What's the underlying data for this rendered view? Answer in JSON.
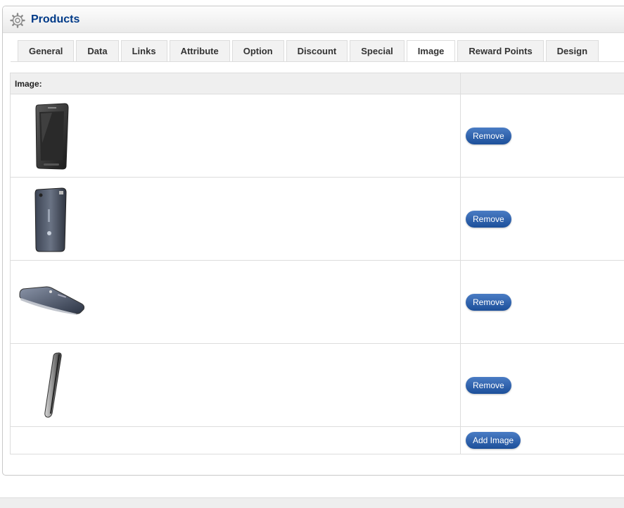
{
  "header": {
    "title": "Products",
    "icon": "gear-icon"
  },
  "tabs": [
    {
      "label": "General"
    },
    {
      "label": "Data"
    },
    {
      "label": "Links"
    },
    {
      "label": "Attribute"
    },
    {
      "label": "Option"
    },
    {
      "label": "Discount"
    },
    {
      "label": "Special"
    },
    {
      "label": "Image",
      "active": true
    },
    {
      "label": "Reward Points"
    },
    {
      "label": "Design"
    }
  ],
  "image_table": {
    "header_label": "Image:",
    "rows": [
      {
        "thumbnail": "phone-front",
        "remove_label": "Remove"
      },
      {
        "thumbnail": "phone-back",
        "remove_label": "Remove"
      },
      {
        "thumbnail": "phone-angled",
        "remove_label": "Remove"
      },
      {
        "thumbnail": "phone-side",
        "remove_label": "Remove"
      }
    ],
    "add_label": "Add Image"
  },
  "colors": {
    "title": "#003a88",
    "button": "#1c4f9a"
  }
}
